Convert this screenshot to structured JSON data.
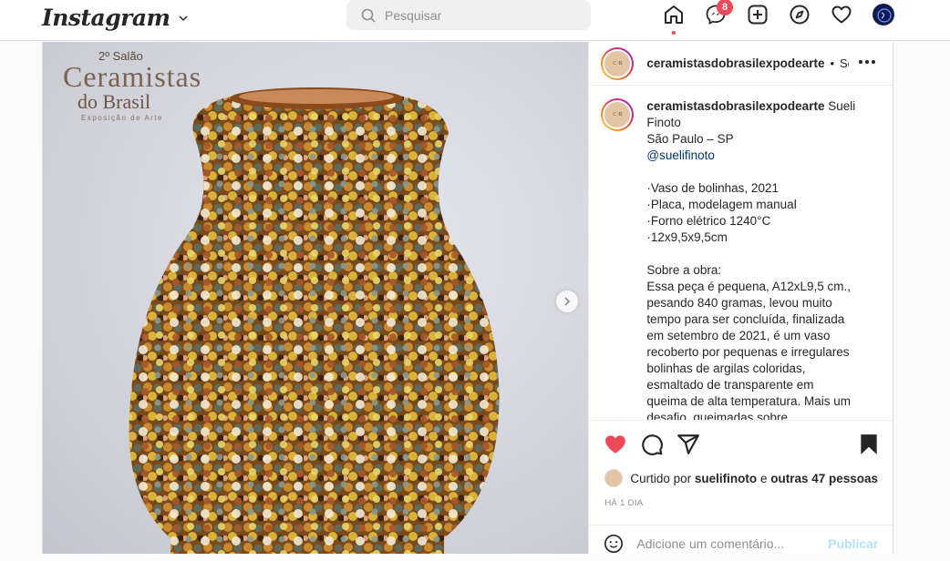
{
  "nav": {
    "logo": "Instagram",
    "search_placeholder": "Pesquisar",
    "messages_badge": "8",
    "icons": [
      "home-icon",
      "messenger-icon",
      "new-post-icon",
      "explore-icon",
      "activity-heart-icon",
      "profile-avatar"
    ]
  },
  "post": {
    "image_watermark": {
      "line1": "2º Salão",
      "line2": "Ceramistas",
      "line3": "do Brasil",
      "line4": "Exposição de Arte"
    },
    "header": {
      "username": "ceramistasdobrasilexpodearte",
      "separator": "•",
      "follow_truncated": "Seguir"
    },
    "caption": {
      "username": "ceramistasdobrasilexpodearte",
      "lines": [
        "Sueli",
        "Finoto",
        "São Paulo – SP",
        "@suelifinoto",
        "",
        "·Vaso de bolinhas, 2021",
        "·Placa, modelagem manual",
        "·Forno elétrico 1240°C",
        "·12x9,5x9,5cm",
        "",
        "Sobre a obra:",
        "Essa peça é pequena, A12xL9,5 cm.,",
        "pesando 840 gramas, levou muito",
        "tempo para ser concluída, finalizada",
        "em setembro de 2021, é um vaso",
        "recoberto por pequenas e irregulares",
        "bolinhas de argilas coloridas,",
        "esmaltado de transparente em",
        "queima de alta temperatura. Mais um",
        "desafio, queimadas sobre"
      ]
    },
    "likes": {
      "prefix": "Curtido por",
      "user": "suelifinoto",
      "middle": "e",
      "others": "outras 47 pessoas"
    },
    "time_ago": "HÁ 1 DIA",
    "comment_placeholder": "Adicione um comentário...",
    "publish_label": "Publicar",
    "colors": {
      "like_red": "#ed4956",
      "publish_blue": "#b2dffc",
      "mention_blue": "#00376b"
    }
  }
}
